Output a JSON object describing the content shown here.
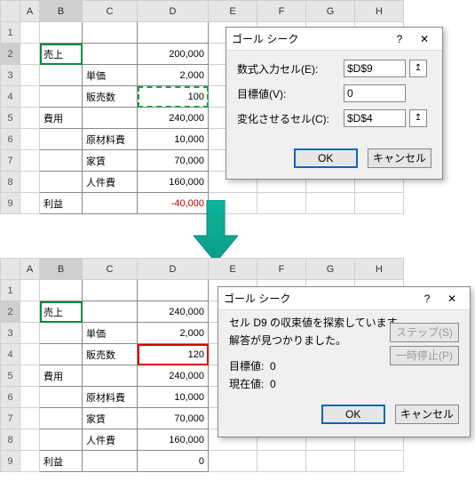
{
  "columns": [
    "A",
    "B",
    "C",
    "D",
    "E",
    "F",
    "G",
    "H"
  ],
  "rows": [
    "1",
    "2",
    "3",
    "4",
    "5",
    "6",
    "7",
    "8",
    "9"
  ],
  "sheet1": {
    "cells": {
      "B2": "売上",
      "D2": "200,000",
      "C3": "単価",
      "D3": "2,000",
      "C4": "販売数",
      "D4": "100",
      "B5": "費用",
      "D5": "240,000",
      "C6": "原材料費",
      "D6": "10,000",
      "C7": "家賃",
      "D7": "70,000",
      "C8": "人件費",
      "D8": "160,000",
      "B9": "利益",
      "D9": "-40,000"
    }
  },
  "sheet2": {
    "cells": {
      "B2": "売上",
      "D2": "240,000",
      "C3": "単価",
      "D3": "2,000",
      "C4": "販売数",
      "D4": "120",
      "B5": "費用",
      "D5": "240,000",
      "C6": "原材料費",
      "D6": "10,000",
      "C7": "家賃",
      "D7": "70,000",
      "C8": "人件費",
      "D8": "160,000",
      "B9": "利益",
      "D9": "0"
    }
  },
  "dialog1": {
    "title": "ゴール シーク",
    "field1_label": "数式入力セル(E):",
    "field1_value": "$D$9",
    "field2_label": "目標値(V):",
    "field2_value": "0",
    "field3_label": "変化させるセル(C):",
    "field3_value": "$D$4",
    "ok": "OK",
    "cancel": "キャンセル"
  },
  "dialog2": {
    "title": "ゴール シーク",
    "line1": "セル D9 の収束値を探索しています。",
    "line2": "解答が見つかりました。",
    "target_label": "目標値:",
    "target_value": "0",
    "current_label": "現在値:",
    "current_value": "0",
    "step": "ステップ(S)",
    "pause": "一時停止(P)",
    "ok": "OK",
    "cancel": "キャンセル"
  }
}
